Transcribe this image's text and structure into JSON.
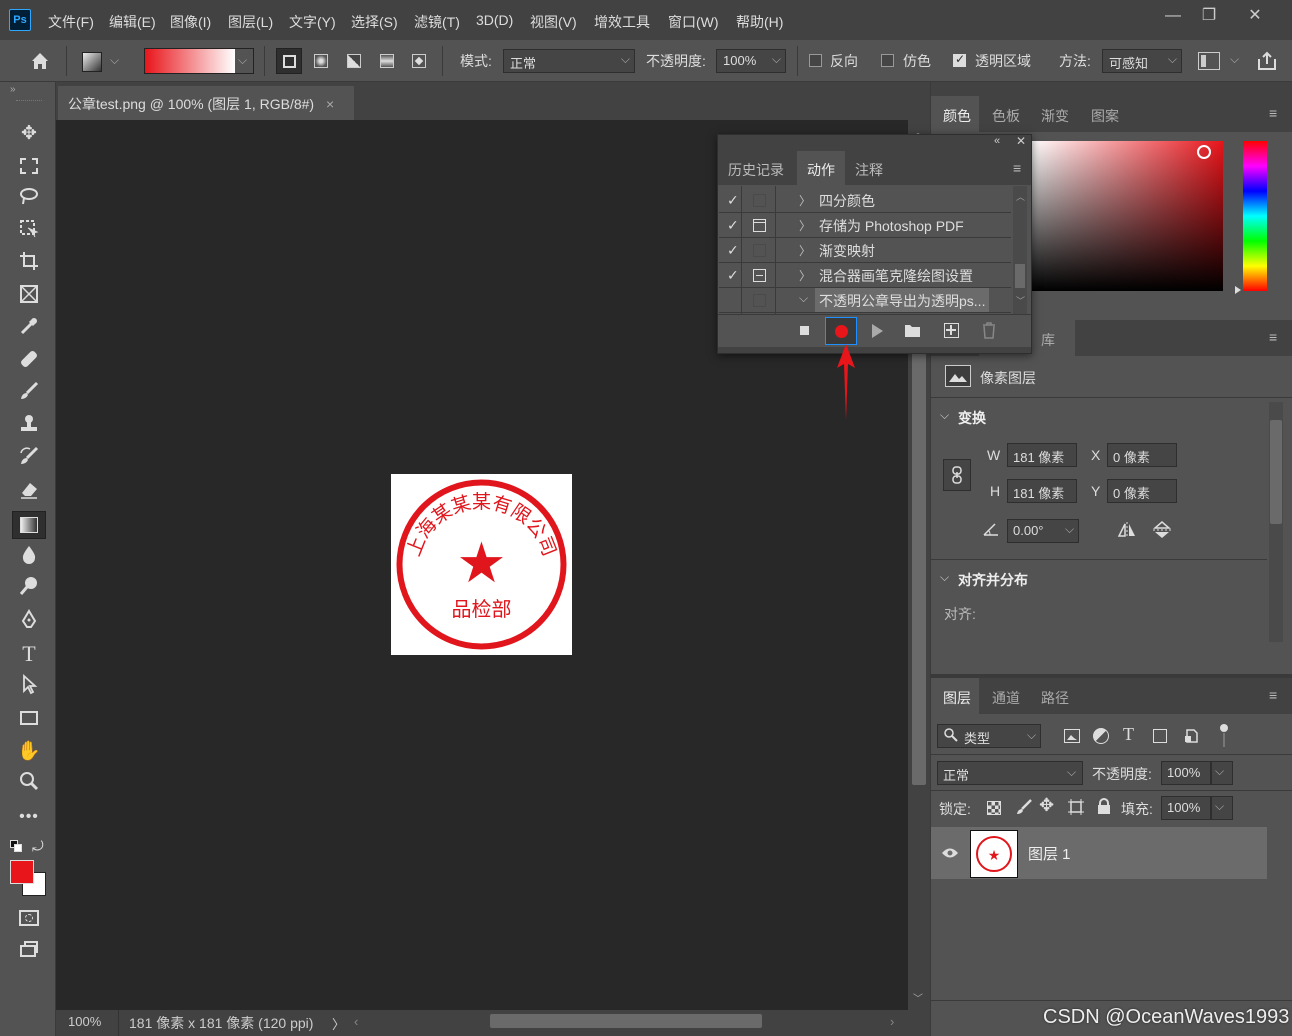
{
  "menubar": {
    "logo": "Ps",
    "items": [
      "文件(F)",
      "编辑(E)",
      "图像(I)",
      "图层(L)",
      "文字(Y)",
      "选择(S)",
      "滤镜(T)",
      "3D(D)",
      "视图(V)",
      "增效工具",
      "窗口(W)",
      "帮助(H)"
    ],
    "window_controls": [
      "—",
      "❐",
      "✕"
    ]
  },
  "options": {
    "mode_label": "模式:",
    "mode_value": "正常",
    "opacity_label": "不透明度:",
    "opacity_value": "100%",
    "reverse_label": "反向",
    "dither_label": "仿色",
    "transparency_label": "透明区域",
    "method_label": "方法:",
    "method_value": "可感知",
    "gradient_start": "#e8151b",
    "gradient_end": "#ffffff"
  },
  "document": {
    "tab_title": "公章test.png @ 100% (图层 1, RGB/8#)",
    "close": "×",
    "zoom": "100%",
    "size_info": "181 像素 x 181 像素 (120 ppi)",
    "status_arrow": "〉"
  },
  "seal": {
    "color": "#e0161c",
    "arc_text": "上海某某某有限公司",
    "bottom_text": "品检部",
    "star": "★"
  },
  "actions_panel": {
    "tabs": [
      "历史记录",
      "动作",
      "注释"
    ],
    "active_tab": "动作",
    "items": [
      {
        "check": "✓",
        "label": "四分颜色",
        "dialog": false,
        "expanded": false
      },
      {
        "check": "✓",
        "label": "存储为 Photoshop PDF",
        "dialog": true,
        "expanded": false
      },
      {
        "check": "✓",
        "label": "渐变映射",
        "dialog": false,
        "expanded": false
      },
      {
        "check": "✓",
        "label": "混合器画笔克隆绘图设置",
        "dialog": true,
        "expanded": false
      },
      {
        "check": "",
        "label": "不透明公章导出为透明ps...",
        "dialog": false,
        "expanded": true
      }
    ],
    "buttons": [
      "stop",
      "record",
      "play",
      "new-set",
      "new-action",
      "delete"
    ],
    "record_color": "#e8151b"
  },
  "color_panel": {
    "tabs": [
      "颜色",
      "色板",
      "渐变",
      "图案"
    ],
    "active_tab": "颜色",
    "hue_color": "#e8151b"
  },
  "properties_panel": {
    "tab_partial": "库",
    "layer_type": "像素图层",
    "transform_title": "变换",
    "w_label": "W",
    "w_value": "181 像素",
    "h_label": "H",
    "h_value": "181 像素",
    "x_label": "X",
    "x_value": "0 像素",
    "y_label": "Y",
    "y_value": "0 像素",
    "angle_value": "0.00°",
    "align_title": "对齐并分布",
    "align_label": "对齐:"
  },
  "layers_panel": {
    "tabs": [
      "图层",
      "通道",
      "路径"
    ],
    "active_tab": "图层",
    "filter_label": "类型",
    "blend_mode": "正常",
    "opacity_label": "不透明度:",
    "opacity_value": "100%",
    "lock_label": "锁定:",
    "fill_label": "填充:",
    "fill_value": "100%",
    "layer_name": "图层 1"
  },
  "tool_colors": {
    "foreground": "#e8151b",
    "background": "#ffffff"
  },
  "watermark": "CSDN @OceanWaves1993"
}
